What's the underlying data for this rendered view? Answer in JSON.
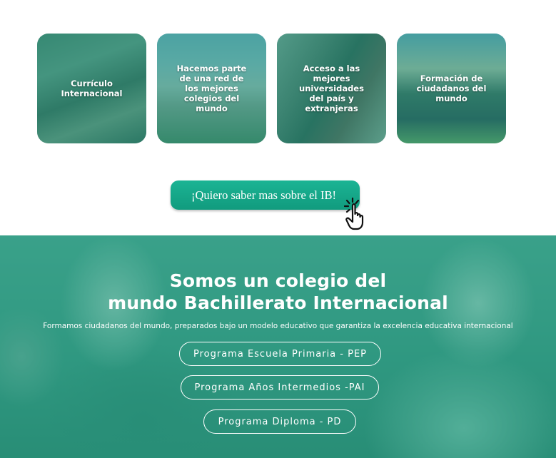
{
  "features": {
    "cards": [
      {
        "label": "Currículo\nInternacional"
      },
      {
        "label": "Hacemos parte\nde una red de\nlos mejores\ncolegios del\nmundo"
      },
      {
        "label": "Acceso a las\nmejores\nuniversidades\ndel país y\nextranjeras"
      },
      {
        "label": "Formación de\nciudadanos del\nmundo"
      }
    ]
  },
  "cta": {
    "label": "¡Quiero saber mas sobre el IB!",
    "icon": "pointer-hand-click-icon"
  },
  "hero": {
    "title": "Somos un colegio del\nmundo Bachillerato Internacional",
    "subtitle": "Formamos ciudadanos del mundo, preparados bajo un modelo educativo que garantiza la excelencia educativa internacional",
    "programs": [
      {
        "label": "Programa Escuela Primaria - PEP"
      },
      {
        "label": "Programa Años Intermedios -PAI"
      },
      {
        "label": "Programa Diploma - PD"
      }
    ]
  },
  "colors": {
    "brand_teal": "#17a88a",
    "card_tint": "#22967a",
    "text_on_brand": "#ffffff"
  }
}
